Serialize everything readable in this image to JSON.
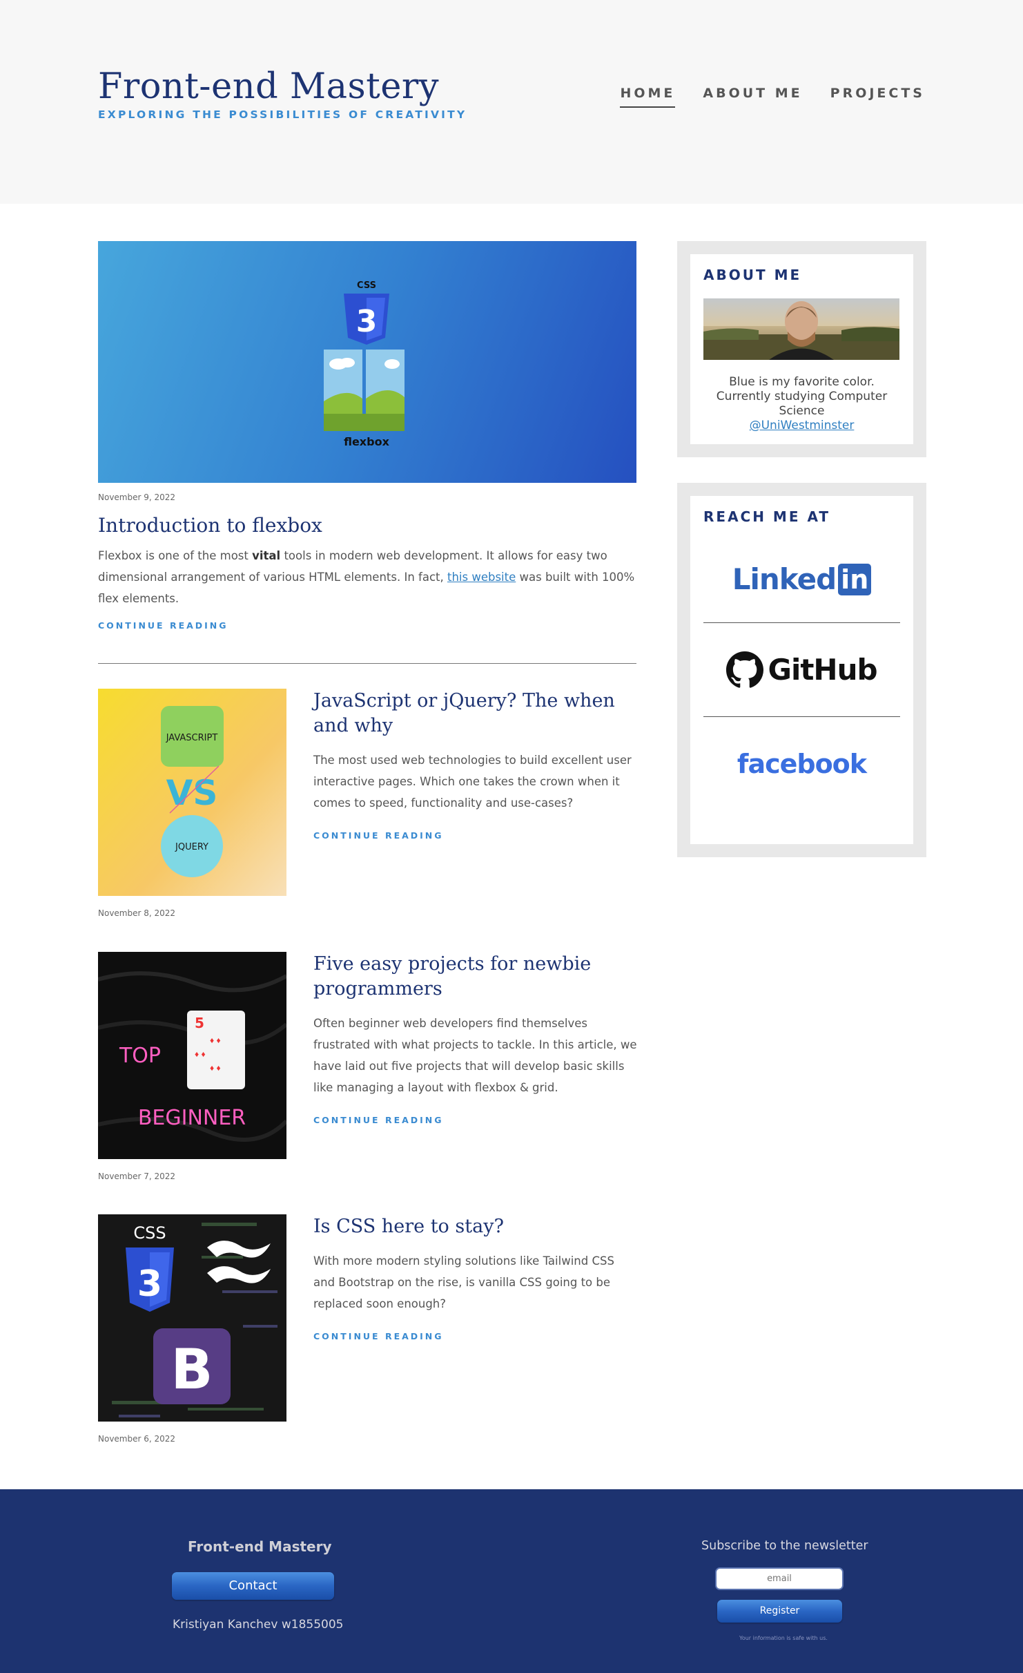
{
  "header": {
    "title": "Front-end Mastery",
    "tagline": "EXPLORING THE POSSIBILITIES OF CREATIVITY",
    "nav": [
      {
        "label": "HOME",
        "active": true
      },
      {
        "label": "ABOUT ME",
        "active": false
      },
      {
        "label": "PROJECTS",
        "active": false
      }
    ]
  },
  "featured": {
    "image_labels": {
      "css": "CSS",
      "flexbox": "flexbox"
    },
    "date": "November 9, 2022",
    "title": "Introduction to flexbox",
    "excerpt_pre": "Flexbox is one of the most ",
    "excerpt_bold": "vital",
    "excerpt_mid": " tools in modern web development. It allows for easy two dimensional arrangement of various HTML elements. In fact, ",
    "excerpt_link": "this website",
    "excerpt_post": " was built with 100% flex elements.",
    "cta": "CONTINUE READING"
  },
  "posts": [
    {
      "title": "JavaScript or jQuery? The when and why",
      "excerpt": "The most used web technologies to build excellent user interactive pages. Which one takes the crown when it comes to speed, functionality and use-cases?",
      "cta": "CONTINUE READING",
      "date": "November 8, 2022",
      "image_labels": {
        "top": "JAVASCRIPT",
        "vs": "VS",
        "bottom": "JQUERY"
      }
    },
    {
      "title": "Five easy projects for newbie programmers",
      "excerpt": "Often beginner web developers find themselves frustrated with what projects to tackle. In this article, we have laid out five projects that will develop basic skills like managing a layout with flexbox & grid.",
      "cta": "CONTINUE READING",
      "date": "November 7, 2022",
      "image_labels": {
        "top": "TOP",
        "bottom": "BEGINNER",
        "card": "5"
      }
    },
    {
      "title": "Is CSS here to stay?",
      "excerpt": "With more modern styling solutions like Tailwind CSS and Bootstrap on the rise, is vanilla CSS going to be replaced soon enough?",
      "cta": "CONTINUE READING",
      "date": "November 6, 2022",
      "image_labels": {
        "css": "CSS",
        "bootstrap": "B"
      }
    }
  ],
  "sidebar": {
    "about_heading": "ABOUT ME",
    "about_text": "Blue is my favorite color. Currently studying Computer Science",
    "about_link": "@UniWestminster",
    "reach_heading": "REACH ME AT",
    "socials": [
      {
        "name": "Linked",
        "suffix": "in",
        "color": "#2f63b8"
      },
      {
        "name": "GitHub",
        "color": "#111111"
      },
      {
        "name": "facebook",
        "color": "#3a6fe0"
      }
    ]
  },
  "footer": {
    "brand": "Front-end Mastery",
    "contact": "Contact",
    "author": "Kristiyan Kanchev w1855005",
    "subscribe": "Subscribe to the newsletter",
    "email_placeholder": "email",
    "register": "Register",
    "safe_note": "Your information is safe with us."
  },
  "colors": {
    "brand": "#1d3372",
    "accent": "#3a8bd1",
    "footer_bg": "#1d3370"
  }
}
